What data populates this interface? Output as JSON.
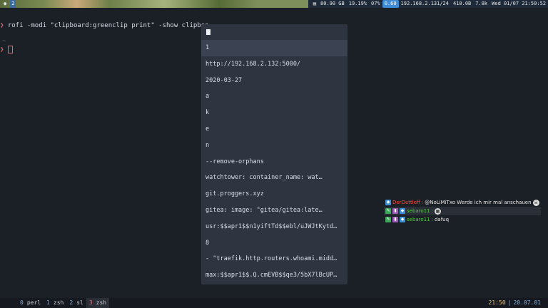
{
  "topbar": {
    "workspaces": [
      "2"
    ],
    "disk": "80.90 GB",
    "cpu": "19.19%",
    "mem": "07%",
    "load": "0.60",
    "ip": "192.168.2.131/24",
    "traffic": "410.0B",
    "rate": "7.8k",
    "datetime": "Wed 01/07 21:50:52"
  },
  "terminal": {
    "prompt_symbol": "❯",
    "command": "rofi -modi \"clipboard:greenclip print\" -show clipboa",
    "tilde": "~"
  },
  "rofi": {
    "items": [
      "1",
      "http://192.168.2.132:5000/",
      "2020-03-27",
      "a",
      "k",
      "e",
      "n",
      "--remove-orphans",
      "watchtower:     container_name: wat…",
      "git.proggers.xyz",
      "gitea:     image: \"gitea/gitea:late…",
      "usr:$$apr1$$n1yiftTd$$ebl/uJWJtKytd…",
      "8",
      "- \"traefik.http.routers.whoami.midd…",
      "max:$$apr1$$.Q.cmEVB$$qe3/5bX7lBcUP…"
    ]
  },
  "chat": {
    "messages": [
      {
        "user": "DerDettleff",
        "text": "@NoLiMiTxo Werde ich mir mal anschauen"
      },
      {
        "user": "sebaro11",
        "text": ""
      },
      {
        "user": "sebaro11",
        "text": "dafuq"
      }
    ]
  },
  "tmux": {
    "windows": [
      {
        "num": "0",
        "name": "perl"
      },
      {
        "num": "1",
        "name": "zsh"
      },
      {
        "num": "2",
        "name": "sl"
      },
      {
        "num": "3",
        "name": "zsh"
      }
    ],
    "time": "21:50",
    "date": "20.07.01"
  }
}
